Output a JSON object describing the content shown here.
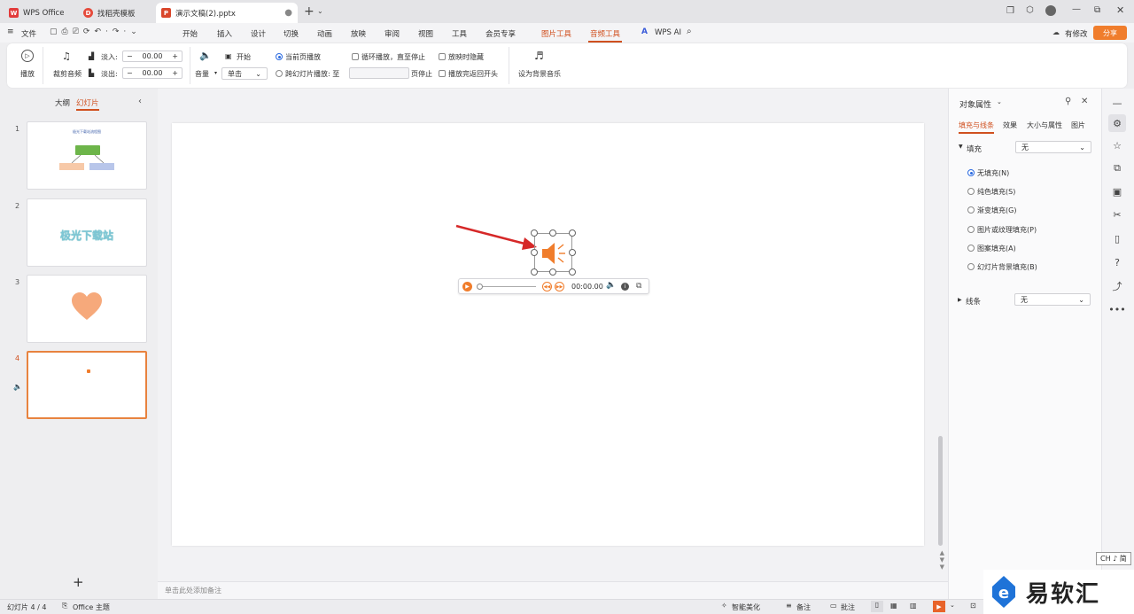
{
  "tabs": {
    "wps": "WPS Office",
    "template": "找稻壳模板",
    "doc": "演示文稿(2).pptx"
  },
  "menu": {
    "file": "文件",
    "items": [
      "开始",
      "插入",
      "设计",
      "切换",
      "动画",
      "放映",
      "审阅",
      "视图",
      "工具",
      "会员专享"
    ],
    "picture_tools": "图片工具",
    "audio_tools": "音频工具",
    "wps_ai": "WPS AI",
    "has_changes": "有修改",
    "share": "分享"
  },
  "ribbon": {
    "play": "播放",
    "trim": "裁剪音频",
    "fade_in": "淡入:",
    "fade_out": "淡出:",
    "fade_in_val": "00.00",
    "fade_out_val": "00.00",
    "volume": "音量",
    "start": "开始",
    "start_mode": "单击",
    "current_page": "当前页播放",
    "cross_slide": "跨幻灯片播放: 至",
    "page_stop": "页停止",
    "loop": "循环播放，直至停止",
    "hide": "放映时隐藏",
    "rewind": "播放完返回开头",
    "bg_music": "设为背景音乐"
  },
  "left": {
    "outline": "大纲",
    "slides": "幻灯片",
    "slide1_title": "极光下载站流程图",
    "slide2_text": "极光下载站",
    "numbers": [
      "1",
      "2",
      "3",
      "4"
    ]
  },
  "player": {
    "time": "00:00.00"
  },
  "notes": "单击此处添加备注",
  "panel": {
    "title": "对象属性",
    "tabs": [
      "填充与线条",
      "效果",
      "大小与属性",
      "图片"
    ],
    "fill": "填充",
    "fill_val": "无",
    "options": [
      "无填充(N)",
      "纯色填充(S)",
      "渐变填充(G)",
      "图片或纹理填充(P)",
      "图案填充(A)",
      "幻灯片背景填充(B)"
    ],
    "line": "线条",
    "line_val": "无"
  },
  "status": {
    "slide_count": "幻灯片 4 / 4",
    "theme": "Office 主题",
    "beautify": "智能美化",
    "notes": "备注",
    "comments": "批注",
    "ime": "CH ♪ 简"
  },
  "watermark": "易软汇",
  "colors": {
    "accent": "#d0501f",
    "speaker": "#f07d2c",
    "arrow": "#d62828"
  }
}
